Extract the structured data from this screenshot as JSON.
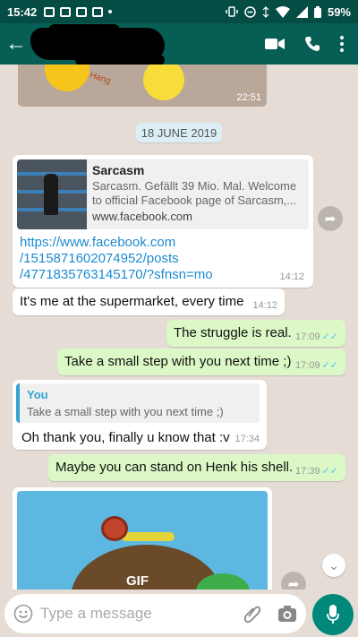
{
  "status_bar": {
    "time": "15:42",
    "battery": "59%"
  },
  "header": {
    "back": "←"
  },
  "messages": [
    {
      "type": "image",
      "time": "22:51",
      "sticker": "Hang"
    },
    {
      "type": "date",
      "text": "18 JUNE 2019"
    },
    {
      "type": "link",
      "preview_title": "Sarcasm",
      "preview_desc": "Sarcasm. Gefällt 39 Mio. Mal. Welcome to official Facebook page of Sarcasm,...",
      "preview_domain": "www.facebook.com",
      "link_line1": "https://www.facebook.com",
      "link_line2": "/1515871602074952/posts",
      "link_line3": "/4771835763145170/?sfnsn=mo",
      "time": "14:12"
    },
    {
      "type": "in",
      "text": "It's me at the supermarket, every time",
      "time": "14:12"
    },
    {
      "type": "out",
      "text": "The struggle is real.",
      "time": "17:09"
    },
    {
      "type": "out",
      "text": "Take a small step with you next time ;)",
      "time": "17:09"
    },
    {
      "type": "in_reply",
      "quote_author": "You",
      "quote_text": "Take a small step with you next time ;)",
      "text": "Oh thank you, finally u know that :v",
      "time": "17:34"
    },
    {
      "type": "out",
      "text": "Maybe you can stand on Henk his shell.",
      "time": "17:39"
    },
    {
      "type": "gif",
      "label": "GIF"
    }
  ],
  "input": {
    "placeholder": "Type a message"
  },
  "ticks_symbol": "✓✓",
  "colors": {
    "header": "#075e54",
    "status": "#054d44",
    "outgoing": "#dcf8c6",
    "accent": "#00897b",
    "link": "#1d8bd1"
  }
}
